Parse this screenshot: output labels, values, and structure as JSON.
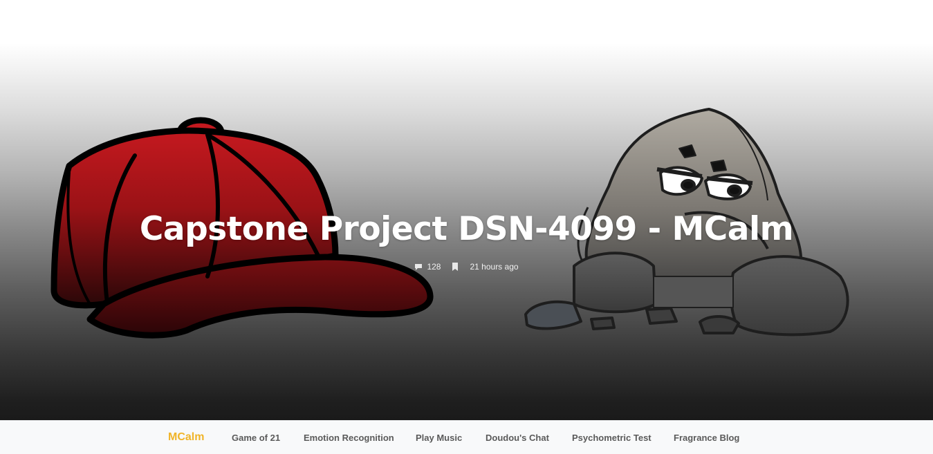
{
  "hero": {
    "title": "Capstone Project DSN-4099 - MCalm",
    "comment_count": "128",
    "time_ago": "21 hours ago",
    "comment_icon": "comment-icon",
    "bookmark_icon": "bookmark-icon"
  },
  "nav": {
    "brand": "MCalm",
    "items": [
      {
        "label": "Game of 21"
      },
      {
        "label": "Emotion Recognition"
      },
      {
        "label": "Play Music"
      },
      {
        "label": "Doudou's Chat"
      },
      {
        "label": "Psychometric Test"
      },
      {
        "label": "Fragrance Blog"
      }
    ]
  },
  "colors": {
    "brand": "#f0b428",
    "nav_text": "#5a5a5a",
    "nav_bg": "#f8f9fa",
    "cap_red": "#b3151c",
    "rock_gray": "#9a958c"
  }
}
